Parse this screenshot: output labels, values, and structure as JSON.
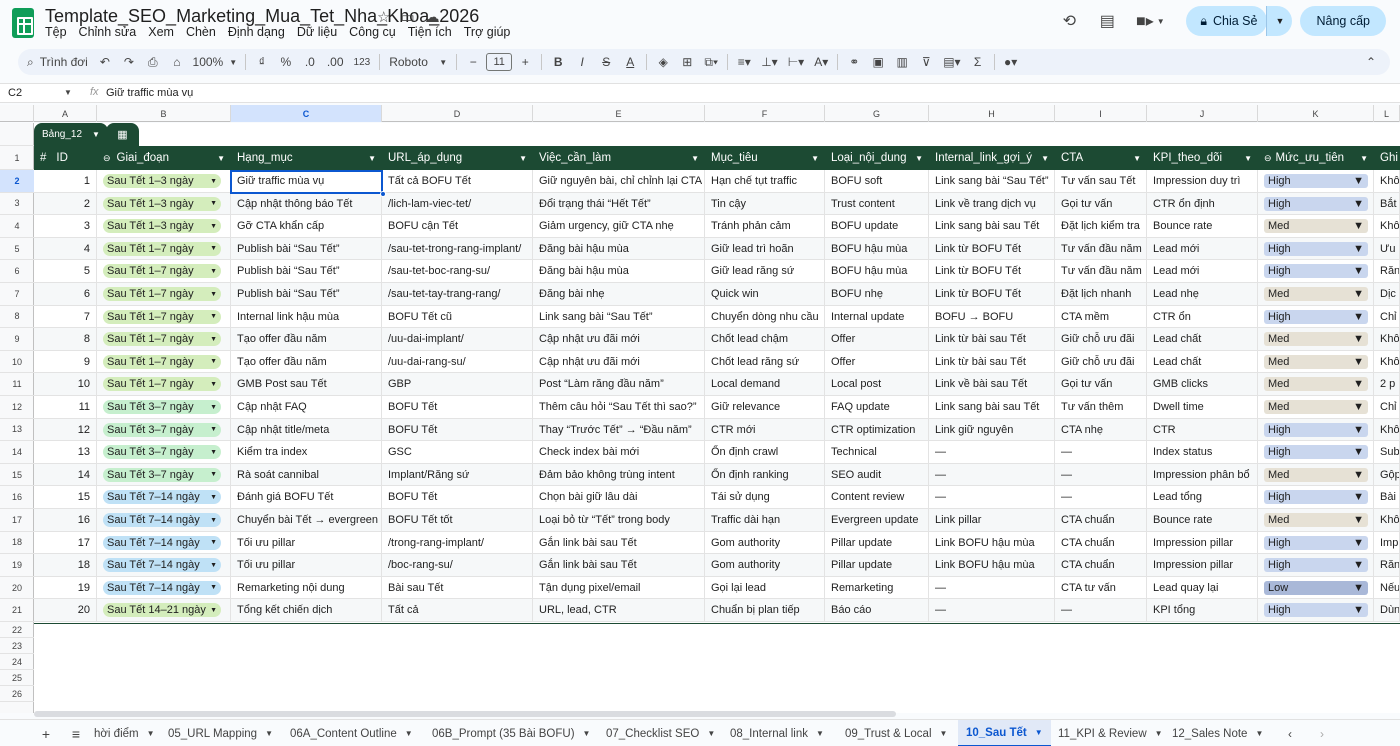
{
  "doc": {
    "title": "Template_SEO_Marketing_Mua_Tet_Nha_Khoa_2026"
  },
  "menu": [
    "Tệp",
    "Chỉnh sửa",
    "Xem",
    "Chèn",
    "Định dạng",
    "Dữ liệu",
    "Công cụ",
    "Tiện ích",
    "Trợ giúp"
  ],
  "actions": {
    "share": "Chia Sẻ",
    "upgrade": "Nâng cấp"
  },
  "toolbar": {
    "search": "Trình đơi",
    "zoom": "100%",
    "currency": "₫",
    "percent": "%",
    "dec_minus": ".0",
    "dec_plus": ".00",
    "num_format": "123",
    "font": "Roboto",
    "font_size": "11",
    "bold": "B",
    "italic": "I",
    "strike": "S",
    "text_color": "A"
  },
  "formula": {
    "cell": "C2",
    "value": "Giữ traffic mùa vụ"
  },
  "columns": [
    "A",
    "B",
    "C",
    "D",
    "E",
    "F",
    "G",
    "H",
    "I",
    "J",
    "K",
    "L"
  ],
  "table": {
    "name": "Bảng_12",
    "headers": [
      "ID",
      "Giai_đoạn",
      "Hạng_mục",
      "URL_áp_dụng",
      "Việc_cần_làm",
      "Mục_tiêu",
      "Loại_nội_dung",
      "Internal_link_gợi_ý",
      "CTA",
      "KPI_theo_dõi",
      "Mức_ưu_tiên",
      "Ghi"
    ]
  },
  "rows": [
    [
      "1",
      "Sau Tết 1–3 ngày",
      "Giữ traffic mùa vụ",
      "Tất cả BOFU Tết",
      "Giữ nguyên bài, chỉ chỉnh lại CTA",
      "Hạn chế tụt traffic",
      "BOFU soft",
      "Link sang bài “Sau Tết”",
      "Tư vấn sau Tết",
      "Impression duy trì",
      "High",
      "Khô"
    ],
    [
      "2",
      "Sau Tết 1–3 ngày",
      "Cập nhật thông báo Tết",
      "/lich-lam-viec-tet/",
      "Đổi trạng thái “Hết Tết”",
      "Tin cậy",
      "Trust content",
      "Link về trang dịch vụ",
      "Gọi tư vấn",
      "CTR ổn định",
      "High",
      "Bắt"
    ],
    [
      "3",
      "Sau Tết 1–3 ngày",
      "Gỡ CTA khẩn cấp",
      "BOFU cận Tết",
      "Giảm urgency, giữ CTA nhẹ",
      "Tránh phản cảm",
      "BOFU update",
      "Link sang bài sau Tết",
      "Đặt lịch kiểm tra",
      "Bounce rate",
      "Med",
      "Khô"
    ],
    [
      "4",
      "Sau Tết 1–7 ngày",
      "Publish bài “Sau Tết”",
      "/sau-tet-trong-rang-implant/",
      "Đăng bài hậu mùa",
      "Giữ lead trì hoãn",
      "BOFU hậu mùa",
      "Link từ BOFU Tết",
      "Tư vấn đầu năm",
      "Lead mới",
      "High",
      "Ưu"
    ],
    [
      "5",
      "Sau Tết 1–7 ngày",
      "Publish bài “Sau Tết”",
      "/sau-tet-boc-rang-su/",
      "Đăng bài hậu mùa",
      "Giữ lead răng sứ",
      "BOFU hậu mùa",
      "Link từ BOFU Tết",
      "Tư vấn đầu năm",
      "Lead mới",
      "High",
      "Răn"
    ],
    [
      "6",
      "Sau Tết 1–7 ngày",
      "Publish bài “Sau Tết”",
      "/sau-tet-tay-trang-rang/",
      "Đăng bài nhẹ",
      "Quick win",
      "BOFU nhẹ",
      "Link từ BOFU Tết",
      "Đặt lịch nhanh",
      "Lead nhẹ",
      "Med",
      "Dịc"
    ],
    [
      "7",
      "Sau Tết 1–7 ngày",
      "Internal link hậu mùa",
      "BOFU Tết cũ",
      "Link sang bài “Sau Tết”",
      "Chuyển dòng nhu cầu",
      "Internal update",
      "BOFU → BOFU",
      "CTA mềm",
      "CTR ổn",
      "High",
      "Chỉ"
    ],
    [
      "8",
      "Sau Tết 1–7 ngày",
      "Tạo offer đầu năm",
      "/uu-dai-implant/",
      "Cập nhật ưu đãi mới",
      "Chốt lead chậm",
      "Offer",
      "Link từ bài sau Tết",
      "Giữ chỗ ưu đãi",
      "Lead chất",
      "Med",
      "Khô"
    ],
    [
      "9",
      "Sau Tết 1–7 ngày",
      "Tạo offer đầu năm",
      "/uu-dai-rang-su/",
      "Cập nhật ưu đãi mới",
      "Chốt lead răng sứ",
      "Offer",
      "Link từ bài sau Tết",
      "Giữ chỗ ưu đãi",
      "Lead chất",
      "Med",
      "Khô"
    ],
    [
      "10",
      "Sau Tết 1–7 ngày",
      "GMB Post sau Tết",
      "GBP",
      "Post “Làm răng đầu năm”",
      "Local demand",
      "Local post",
      "Link về bài sau Tết",
      "Gọi tư vấn",
      "GMB clicks",
      "Med",
      "2 p"
    ],
    [
      "11",
      "Sau Tết 3–7 ngày",
      "Cập nhật FAQ",
      "BOFU Tết",
      "Thêm câu hỏi “Sau Tết thì sao?”",
      "Giữ relevance",
      "FAQ update",
      "Link sang bài sau Tết",
      "Tư vấn thêm",
      "Dwell time",
      "Med",
      "Chỉ"
    ],
    [
      "12",
      "Sau Tết 3–7 ngày",
      "Cập nhật title/meta",
      "BOFU Tết",
      "Thay “Trước Tết” → “Đầu năm”",
      "CTR mới",
      "CTR optimization",
      "Link giữ nguyên",
      "CTA nhẹ",
      "CTR",
      "High",
      "Khô"
    ],
    [
      "13",
      "Sau Tết 3–7 ngày",
      "Kiểm tra index",
      "GSC",
      "Check index bài mới",
      "Ổn định crawl",
      "Technical",
      "—",
      "—",
      "Index status",
      "High",
      "Sub"
    ],
    [
      "14",
      "Sau Tết 3–7 ngày",
      "Rà soát cannibal",
      "Implant/Răng sứ",
      "Đảm bảo không trùng intent",
      "Ổn định ranking",
      "SEO audit",
      "—",
      "—",
      "Impression phân bổ",
      "Med",
      "Gộp"
    ],
    [
      "15",
      "Sau Tết 7–14 ngày",
      "Đánh giá BOFU Tết",
      "BOFU Tết",
      "Chọn bài giữ lâu dài",
      "Tái sử dụng",
      "Content review",
      "—",
      "—",
      "Lead tổng",
      "High",
      "Bài"
    ],
    [
      "16",
      "Sau Tết 7–14 ngày",
      "Chuyển bài Tết → evergreen",
      "BOFU Tết tốt",
      "Loại bỏ từ “Tết” trong body",
      "Traffic dài hạn",
      "Evergreen update",
      "Link pillar",
      "CTA chuẩn",
      "Bounce rate",
      "Med",
      "Khô"
    ],
    [
      "17",
      "Sau Tết 7–14 ngày",
      "Tối ưu pillar",
      "/trong-rang-implant/",
      "Gắn link bài sau Tết",
      "Gom authority",
      "Pillar update",
      "Link BOFU hậu mùa",
      "CTA chuẩn",
      "Impression pillar",
      "High",
      "Imp"
    ],
    [
      "18",
      "Sau Tết 7–14 ngày",
      "Tối ưu pillar",
      "/boc-rang-su/",
      "Gắn link bài sau Tết",
      "Gom authority",
      "Pillar update",
      "Link BOFU hậu mùa",
      "CTA chuẩn",
      "Impression pillar",
      "High",
      "Răn"
    ],
    [
      "19",
      "Sau Tết 7–14 ngày",
      "Remarketing nội dung",
      "Bài sau Tết",
      "Tận dụng pixel/email",
      "Gọi lại lead",
      "Remarketing",
      "—",
      "CTA tư vấn",
      "Lead quay lại",
      "Low",
      "Nếu"
    ],
    [
      "20",
      "Sau Tết 14–21 ngày",
      "Tổng kết chiến dịch",
      "Tất cả",
      "URL, lead, CTR",
      "Chuẩn bị plan tiếp",
      "Báo cáo",
      "—",
      "—",
      "KPI tổng",
      "High",
      "Dùn"
    ]
  ],
  "empty_row_numbers": [
    "22",
    "23",
    "24",
    "25",
    "26"
  ],
  "sheets": [
    "hời điểm",
    "05_URL Mapping",
    "06A_Content Outline",
    "06B_Prompt (35 Bài BOFU)",
    "07_Checklist SEO",
    "08_Internal link",
    "09_Trust & Local",
    "10_Sau Tết",
    "11_KPI & Review",
    "12_Sales Note"
  ],
  "active_sheet": "10_Sau Tết",
  "colors": {
    "header_green": "#1c4a33",
    "phase_1_3": "#d4edbc",
    "phase_1_7": "#d4edbc",
    "phase_3_7": "#c6efce",
    "phase_7_14": "#bfe1f6",
    "phase_14_21": "#d4edbc",
    "prio_high": "#c9d6ee",
    "prio_med": "#e6e1d5",
    "prio_low": "#a9b8d8",
    "accent": "#0b57d0"
  }
}
